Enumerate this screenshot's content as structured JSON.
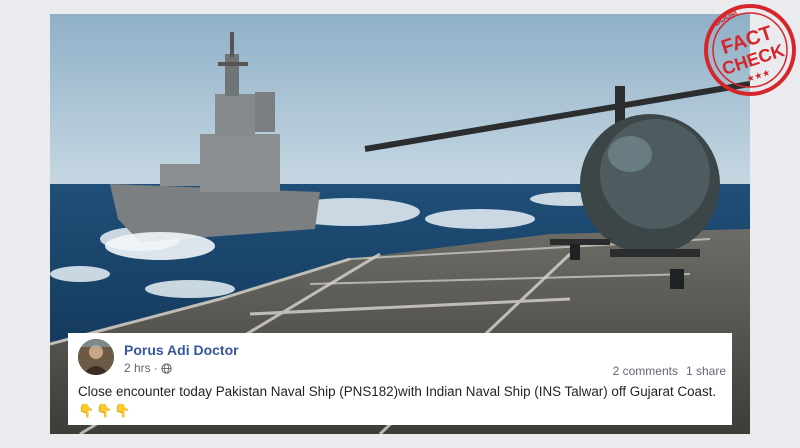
{
  "post": {
    "author": "Porus Adi Doctor",
    "time": "2 hrs",
    "separator": "·",
    "privacy_icon": "globe-icon",
    "comments": "2 comments",
    "shares": "1 share",
    "text": "Close encounter today Pakistan Naval Ship (PNS182)with Indian Naval Ship (INS Talwar) off Gujarat Coast.",
    "emojis": "👇👇👇"
  },
  "stamp": {
    "brand": "BOOM",
    "line1": "FACT",
    "line2": "CHECK",
    "color": "#d6262b"
  },
  "colors": {
    "author_link": "#365899",
    "meta_text": "#616770",
    "body_text": "#1d2129"
  }
}
